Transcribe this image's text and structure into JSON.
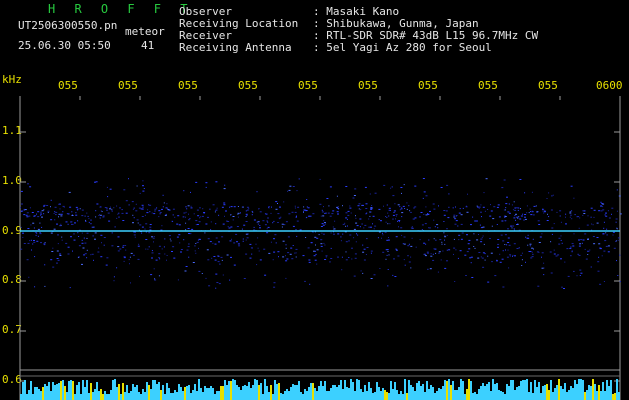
{
  "header": {
    "title": "H R O F F T",
    "filename": "UT2506300550.pn",
    "mode": "meteor",
    "datetime": "25.06.30 05:50",
    "count": "41",
    "fields": [
      {
        "label": "Observer",
        "value": ": Masaki Kano"
      },
      {
        "label": "Receiving Location",
        "value": ": Shibukawa, Gunma, Japan"
      },
      {
        "label": "Receiver",
        "value": ": RTL-SDR SDR# 43dB L15 96.7MHz CW"
      },
      {
        "label": "Receiving Antenna",
        "value": ": 5el Yagi Az 280 for Seoul"
      }
    ]
  },
  "axis": {
    "y_unit": "kHz",
    "y_ticks": [
      "1.1",
      "1.0",
      "0.9",
      "0.8",
      "0.7",
      "0.6"
    ],
    "x_ticks": [
      "055",
      "055",
      "055",
      "055",
      "055",
      "055",
      "055",
      "055",
      "055",
      "0600"
    ]
  },
  "colors": {
    "background": "#000000",
    "label_yellow": "#e8e000",
    "title_green": "#27c93f",
    "signal_blue": "#2a3cff",
    "carrier_cyan": "#3cd0ff",
    "grid_gray": "#9a9a9a"
  }
}
